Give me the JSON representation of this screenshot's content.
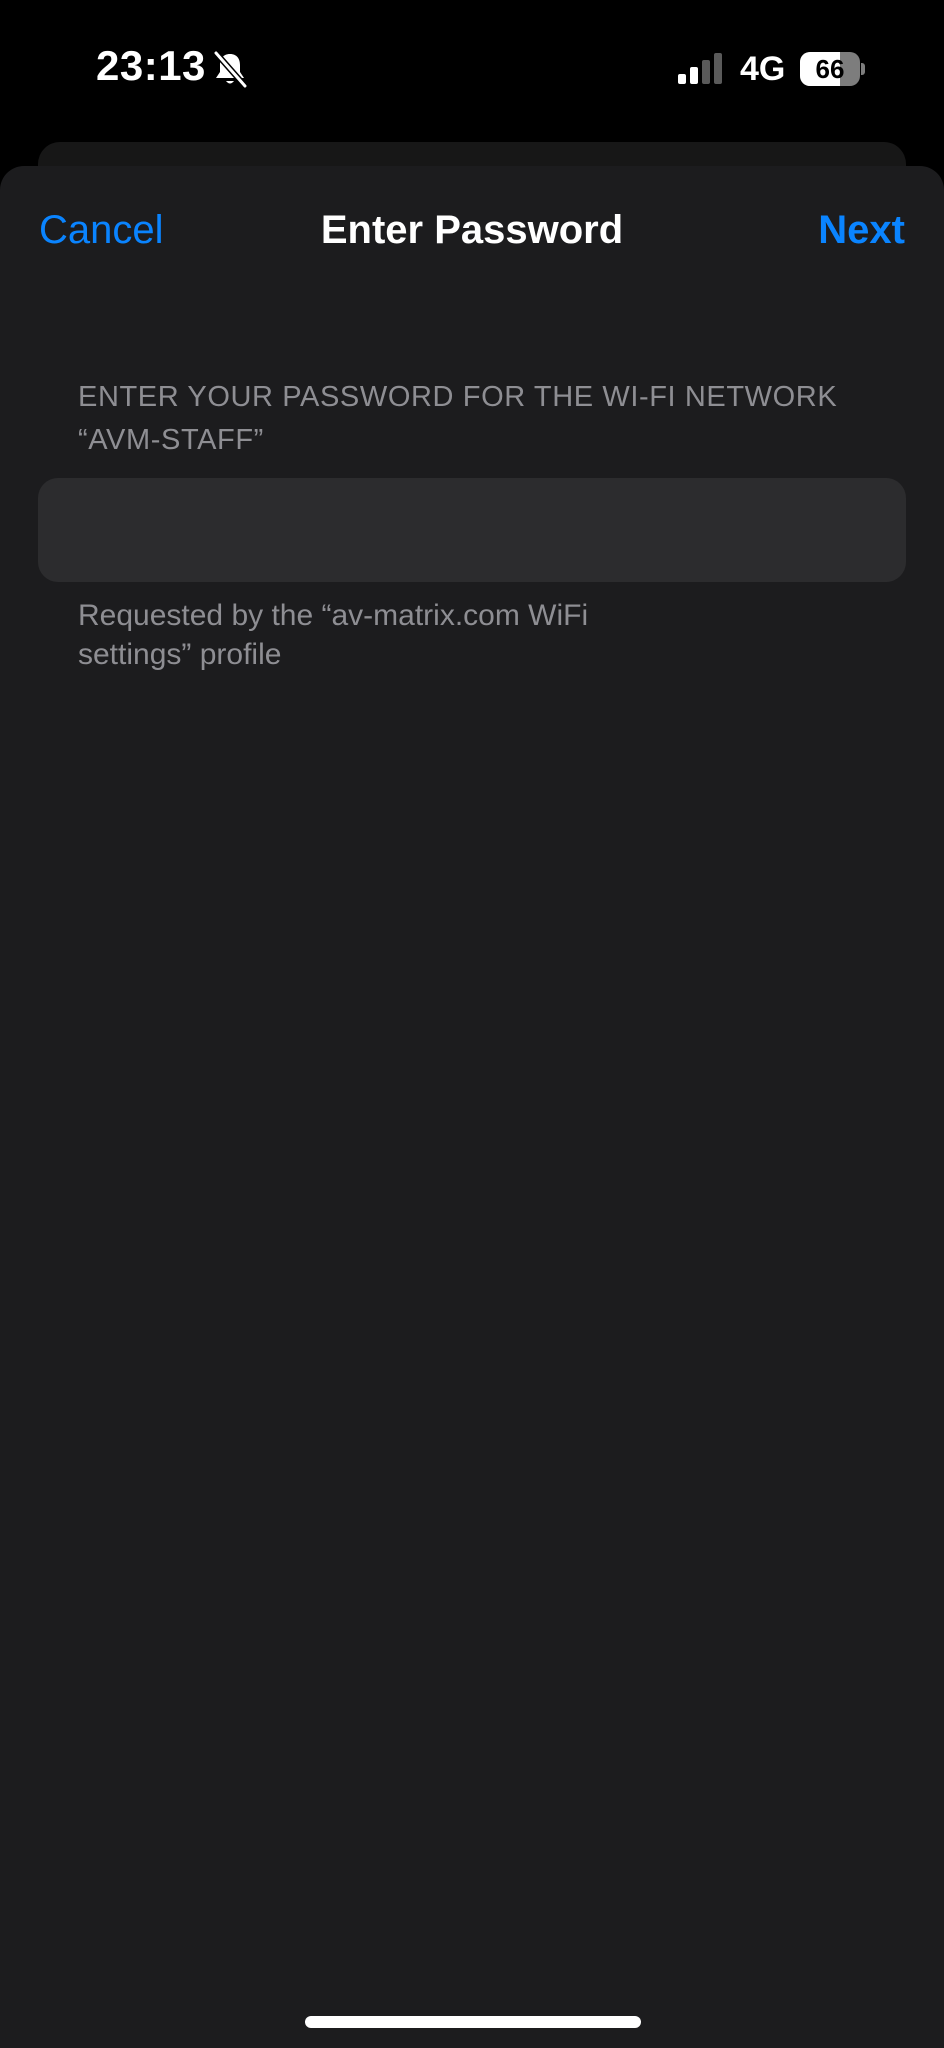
{
  "status_bar": {
    "time": "23:13",
    "network": "4G",
    "battery_level": "66",
    "battery_fraction": 0.66,
    "signal_bars_active": 2,
    "signal_bars_total": 4,
    "icons": [
      "bell-slash-icon",
      "signal-icon",
      "battery-icon"
    ]
  },
  "nav": {
    "cancel_label": "Cancel",
    "title": "Enter Password",
    "next_label": "Next"
  },
  "form": {
    "header": "ENTER YOUR PASSWORD FOR THE WI-FI NETWORK “AVM-STAFF”",
    "password_value": "",
    "footer": "Requested by the “av-matrix.com WiFi settings” profile"
  },
  "colors": {
    "accent": "#0a84ff",
    "sheet_background": "#1c1c1e",
    "field_background": "#2c2c2e",
    "secondary_text": "#8e8e93"
  }
}
